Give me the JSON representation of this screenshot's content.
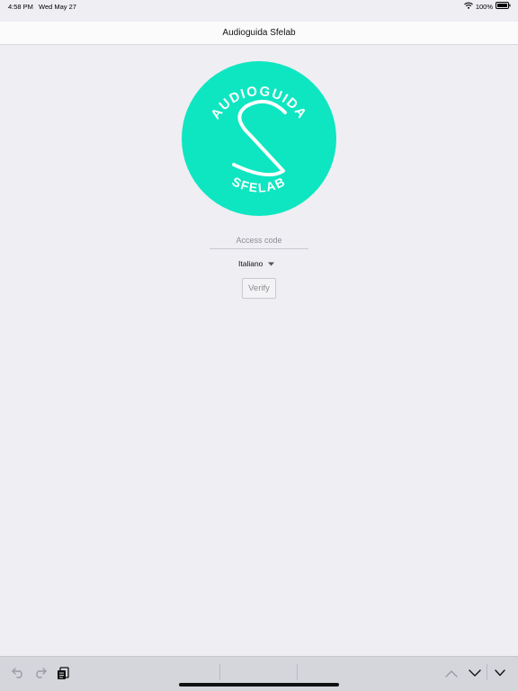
{
  "status_bar": {
    "time": "4:58 PM",
    "date": "Wed May 27",
    "battery": "100%"
  },
  "nav": {
    "title": "Audioguida Sfelab"
  },
  "logo": {
    "top_text": "AUDIOGUIDA",
    "bottom_text": "SFELAB",
    "color": "#0ee6c1"
  },
  "form": {
    "access_code": {
      "value": "",
      "placeholder": "Access code"
    },
    "language": {
      "selected": "Italiano"
    },
    "verify_label": "Verify"
  },
  "toolbar": {
    "icons": [
      "undo-icon",
      "redo-icon",
      "paste-icon",
      "chevron-up-icon",
      "chevron-down-icon",
      "dismiss-keyboard-icon"
    ]
  }
}
